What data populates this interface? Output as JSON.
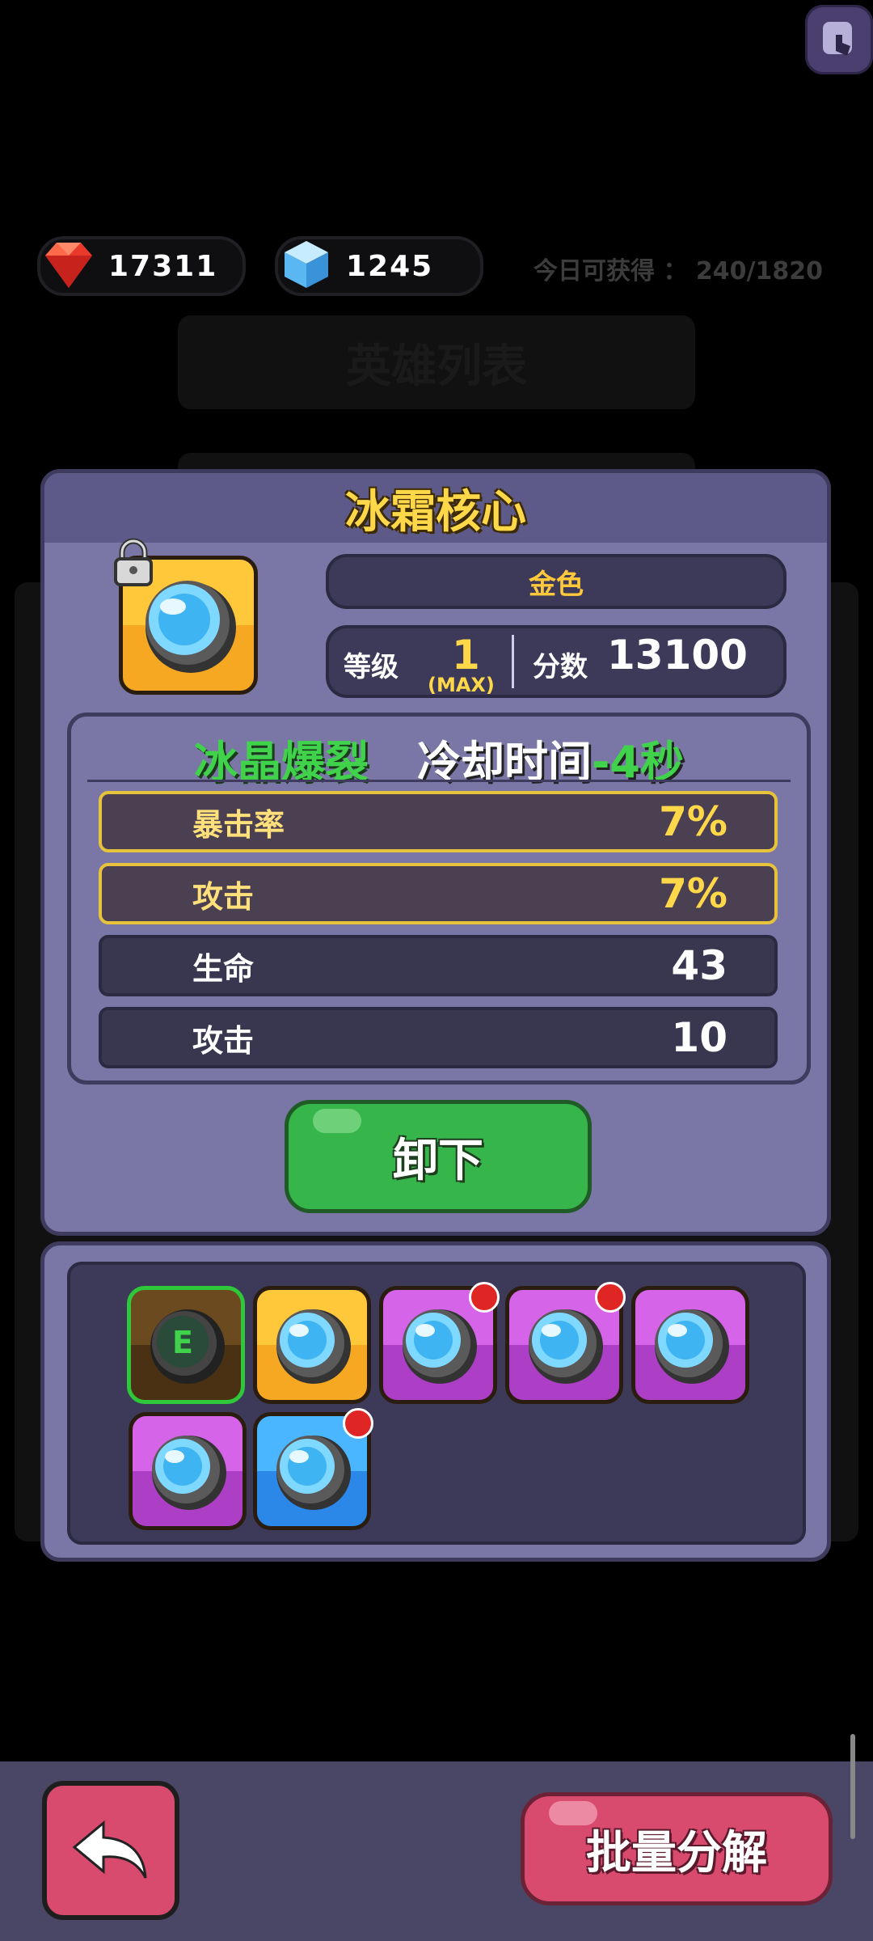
{
  "currencies": {
    "gems": "17311",
    "cubes": "1245",
    "gem_icon": "red-gem-icon",
    "cube_icon": "blue-ice-cube-icon"
  },
  "daily": "今日可获得 ： 240/1820",
  "background_tab_title": "英雄列表",
  "item": {
    "title": "冰霜核心",
    "rarity": "金色",
    "level_label": "等级",
    "level": "1",
    "level_max": "(MAX)",
    "score_label": "分数",
    "score": "13100"
  },
  "skill": {
    "name": "冰晶爆裂",
    "cooldown_label": "冷却时间",
    "cooldown_value": "-4秒"
  },
  "stats": [
    {
      "label": "暴击率",
      "value": "7%"
    },
    {
      "label": "攻击",
      "value": "7%"
    },
    {
      "label": "生命",
      "value": "43"
    },
    {
      "label": "攻击",
      "value": "10"
    }
  ],
  "unequip_label": "卸下",
  "inventory": {
    "e_label": "E"
  },
  "bulk_label": "批量分解",
  "colors": {
    "gold": "#f7a823",
    "purple": "#ad3fc6",
    "blue": "#2b87e8",
    "green": "#36b54a",
    "pink": "#d94b6e",
    "highlight_border": "#e6c33a"
  }
}
